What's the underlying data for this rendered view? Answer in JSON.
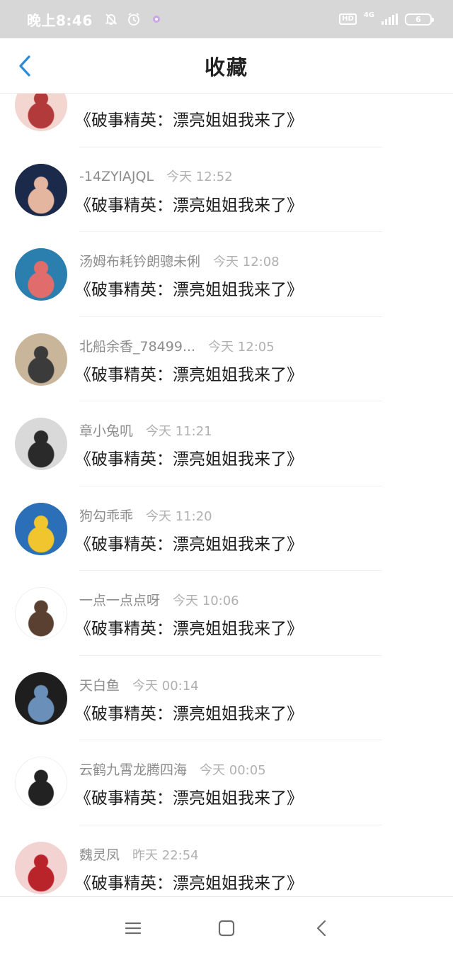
{
  "status_bar": {
    "time": "晚上8:46",
    "hd": "HD",
    "network": "4G",
    "battery": "6"
  },
  "header": {
    "title": "收藏"
  },
  "items": [
    {
      "name": "",
      "time": "",
      "message": "《破事精英：漂亮姐姐我来了》",
      "avatar_colors": [
        "#f2d6cf",
        "#b23a3a"
      ]
    },
    {
      "name": "-14ZYlAJQL",
      "time": "今天 12:52",
      "message": "《破事精英：漂亮姐姐我来了》",
      "avatar_colors": [
        "#1b2a4a",
        "#e4b6a0"
      ]
    },
    {
      "name": "汤姆布耗钤朗骢未俐",
      "time": "今天 12:08",
      "message": "《破事精英：漂亮姐姐我来了》",
      "avatar_colors": [
        "#2b7fae",
        "#e06c6c"
      ]
    },
    {
      "name": "北船余香_78499...",
      "time": "今天 12:05",
      "message": "《破事精英：漂亮姐姐我来了》",
      "avatar_colors": [
        "#c9b59a",
        "#3b3b3b"
      ]
    },
    {
      "name": "章小兔叽",
      "time": "今天 11:21",
      "message": "《破事精英：漂亮姐姐我来了》",
      "avatar_colors": [
        "#d9d9d9",
        "#2a2a2a"
      ]
    },
    {
      "name": "狗勾乖乖",
      "time": "今天 11:20",
      "message": "《破事精英：漂亮姐姐我来了》",
      "avatar_colors": [
        "#2a6fb8",
        "#f0c52e"
      ]
    },
    {
      "name": "一点一点点呀",
      "time": "今天 10:06",
      "message": "《破事精英：漂亮姐姐我来了》",
      "avatar_colors": [
        "#ffffff",
        "#5a4030"
      ]
    },
    {
      "name": "天白鱼",
      "time": "今天 00:14",
      "message": "《破事精英：漂亮姐姐我来了》",
      "avatar_colors": [
        "#1e1e1e",
        "#6a8fb8"
      ]
    },
    {
      "name": "云鹤九霄龙腾四海",
      "time": "今天 00:05",
      "message": "《破事精英：漂亮姐姐我来了》",
      "avatar_colors": [
        "#ffffff",
        "#222222"
      ]
    },
    {
      "name": "魏灵凤",
      "time": "昨天 22:54",
      "message": "《破事精英：漂亮姐姐我来了》",
      "avatar_colors": [
        "#f3d2d2",
        "#b8242a"
      ]
    }
  ],
  "colors": {
    "status_bar_bg": "#d7d7d7",
    "accent_blue": "#2a8bd8",
    "name_gray": "#8d8d8d",
    "time_gray": "#b0b0b0"
  }
}
